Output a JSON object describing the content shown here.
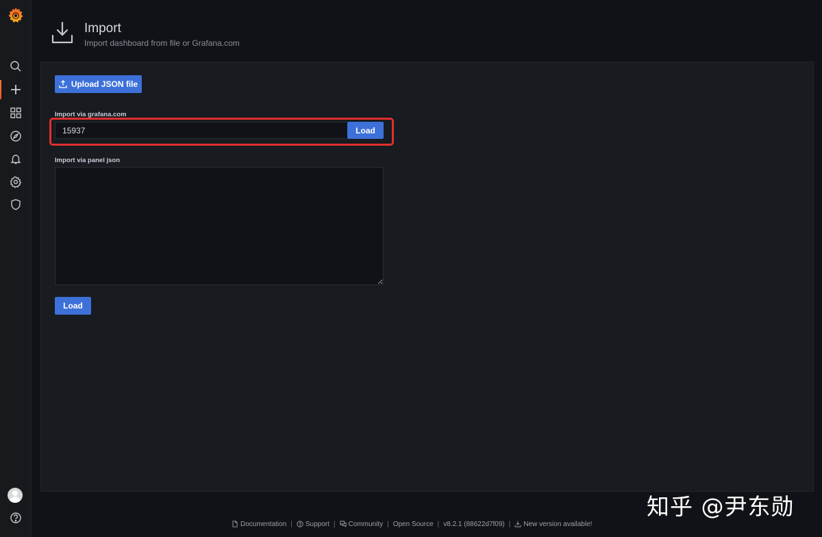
{
  "header": {
    "title": "Import",
    "subtitle": "Import dashboard from file or Grafana.com"
  },
  "upload": {
    "label": "Upload JSON file"
  },
  "grafana_import": {
    "label": "Import via grafana.com",
    "value": "15937",
    "load_label": "Load"
  },
  "panel_json": {
    "label": "Import via panel json",
    "value": "",
    "load_label": "Load"
  },
  "footer": {
    "documentation": "Documentation",
    "support": "Support",
    "community": "Community",
    "open_source": "Open Source",
    "version": "v8.2.1 (88622d7f09)",
    "new_version": "New version available!"
  },
  "watermark": "知乎 @尹东勋",
  "colors": {
    "accent_orange": "#f05a28",
    "primary_blue": "#3d71d9",
    "highlight_red": "#e02f2f"
  },
  "icons": {
    "sidebar": [
      "search-icon",
      "plus-icon",
      "dashboards-icon",
      "explore-icon",
      "bell-icon",
      "gear-icon",
      "shield-icon"
    ],
    "bottom": [
      "avatar",
      "help-icon"
    ]
  }
}
